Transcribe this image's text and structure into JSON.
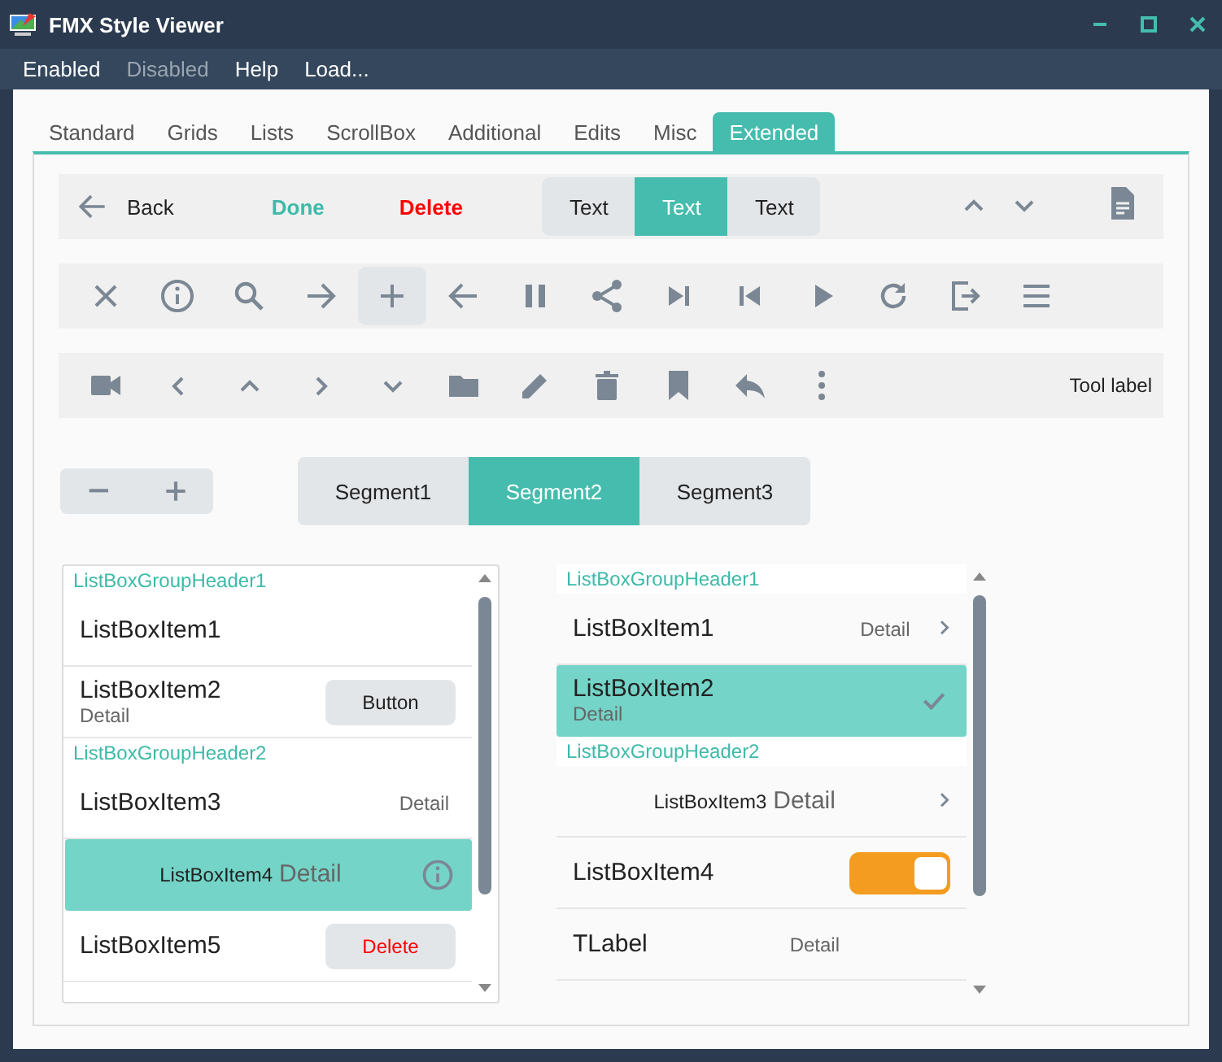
{
  "window": {
    "title": "FMX Style Viewer"
  },
  "menu": [
    {
      "label": "Enabled",
      "disabled": false
    },
    {
      "label": "Disabled",
      "disabled": true
    },
    {
      "label": "Help",
      "disabled": false
    },
    {
      "label": "Load...",
      "disabled": false
    }
  ],
  "tabs": [
    {
      "label": "Standard",
      "selected": false
    },
    {
      "label": "Grids",
      "selected": false
    },
    {
      "label": "Lists",
      "selected": false
    },
    {
      "label": "ScrollBox",
      "selected": false
    },
    {
      "label": "Additional",
      "selected": false
    },
    {
      "label": "Edits",
      "selected": false
    },
    {
      "label": "Misc",
      "selected": false
    },
    {
      "label": "Extended",
      "selected": true
    }
  ],
  "toolbar_1": {
    "back": {
      "label": "Back"
    },
    "actions": [
      {
        "label": "Done",
        "color": "#3dbaa8"
      },
      {
        "label": "Delete",
        "color": "#ff0000"
      }
    ],
    "segments": [
      {
        "label": "Text",
        "selected": false
      },
      {
        "label": "Text",
        "selected": true
      },
      {
        "label": "Text",
        "selected": false
      }
    ]
  },
  "toolbar_2": {
    "buttons": [
      {
        "pressed": false
      },
      {
        "pressed": false
      },
      {
        "pressed": false
      },
      {
        "pressed": false
      },
      {
        "pressed": true
      },
      {
        "pressed": false
      },
      {
        "pressed": false
      },
      {
        "pressed": false
      },
      {
        "pressed": false
      },
      {
        "pressed": false
      },
      {
        "pressed": false
      },
      {
        "pressed": false
      },
      {
        "pressed": false
      },
      {
        "pressed": false
      }
    ]
  },
  "toolbar_3": {
    "label": "Tool label"
  },
  "segments": [
    {
      "label": "Segment1",
      "selected": false
    },
    {
      "label": "Segment2",
      "selected": true
    },
    {
      "label": "Segment3",
      "selected": false
    }
  ],
  "list_left": {
    "items": [
      {
        "kind": "header",
        "text": "ListBoxGroupHeader1"
      },
      {
        "kind": "item",
        "text": "ListBoxItem1",
        "selected": false
      },
      {
        "kind": "item",
        "text": "ListBoxItem2",
        "detail": {
          "kind": "below",
          "text": "Detail"
        },
        "accessory": {
          "kind": "button",
          "label": "Button"
        },
        "selected": false
      },
      {
        "kind": "header",
        "text": "ListBoxGroupHeader2"
      },
      {
        "kind": "item",
        "text": "ListBoxItem3",
        "detail": {
          "kind": "right",
          "text": "Detail"
        },
        "selected": false
      },
      {
        "kind": "item",
        "text": "ListBoxItem4",
        "detail": {
          "kind": "inline",
          "text": "Detail"
        },
        "accessory": {
          "kind": "info"
        },
        "selected": true
      },
      {
        "kind": "item",
        "text": "ListBoxItem5",
        "accessory": {
          "kind": "delete-button",
          "label": "Delete"
        },
        "selected": false
      }
    ]
  },
  "list_right": {
    "items": [
      {
        "kind": "header",
        "text": "ListBoxGroupHeader1"
      },
      {
        "kind": "item",
        "text": "ListBoxItem1",
        "detail": {
          "kind": "right",
          "text": "Detail"
        },
        "accessory": {
          "kind": "chevron"
        },
        "selected": false
      },
      {
        "kind": "item",
        "text": "ListBoxItem2",
        "detail": {
          "kind": "below",
          "text": "Detail"
        },
        "accessory": {
          "kind": "check"
        },
        "selected": true
      },
      {
        "kind": "header",
        "text": "ListBoxGroupHeader2"
      },
      {
        "kind": "item",
        "text": "ListBoxItem3",
        "detail": {
          "kind": "inline",
          "text": "Detail"
        },
        "accessory": {
          "kind": "chevron"
        },
        "selected": false
      },
      {
        "kind": "item",
        "text": "ListBoxItem4",
        "accessory": {
          "kind": "switch",
          "on": true
        },
        "selected": false
      },
      {
        "kind": "item",
        "text": "TLabel",
        "detail": {
          "kind": "middle",
          "text": "Detail"
        },
        "selected": false
      }
    ]
  }
}
